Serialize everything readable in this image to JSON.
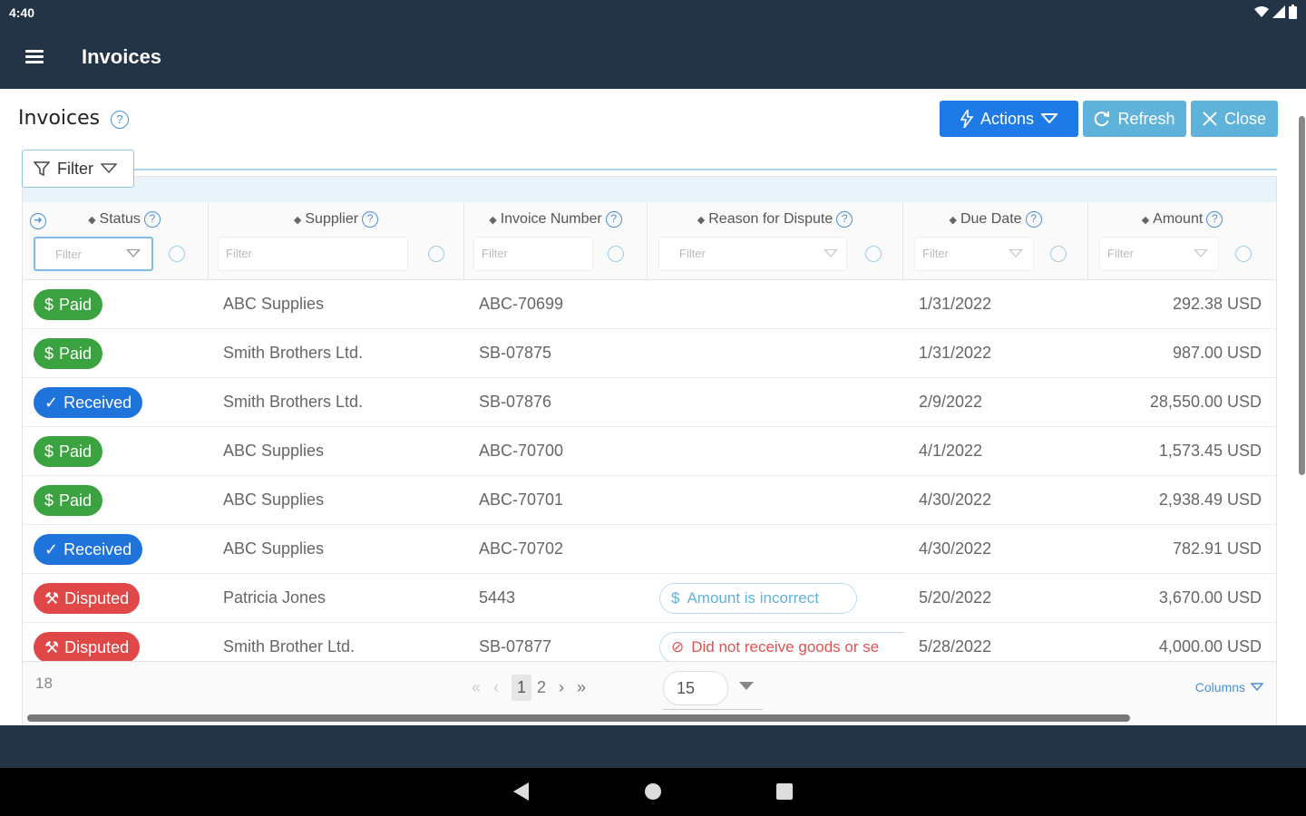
{
  "status_bar": {
    "time": "4:40"
  },
  "app_bar": {
    "title": "Invoices"
  },
  "page": {
    "title": "Invoices",
    "help_glyph": "?"
  },
  "toolbar": {
    "actions_label": "Actions",
    "refresh_label": "Refresh",
    "close_label": "Close"
  },
  "filter": {
    "label": "Filter"
  },
  "columns": [
    {
      "key": "status",
      "label": "Status",
      "filter_placeholder": "Filter"
    },
    {
      "key": "supplier",
      "label": "Supplier",
      "filter_placeholder": "Filter"
    },
    {
      "key": "invoice_number",
      "label": "Invoice Number",
      "filter_placeholder": "Filter"
    },
    {
      "key": "reason",
      "label": "Reason for Dispute",
      "filter_placeholder": "Filter"
    },
    {
      "key": "due_date",
      "label": "Due Date",
      "filter_placeholder": "Filter"
    },
    {
      "key": "amount",
      "label": "Amount",
      "filter_placeholder": "Filter"
    }
  ],
  "rows": [
    {
      "status": "Paid",
      "supplier": "ABC Supplies",
      "invoice_number": "ABC-70699",
      "reason": "",
      "due_date": "1/31/2022",
      "amount": "292.38 USD"
    },
    {
      "status": "Paid",
      "supplier": "Smith Brothers Ltd.",
      "invoice_number": "SB-07875",
      "reason": "",
      "due_date": "1/31/2022",
      "amount": "987.00 USD"
    },
    {
      "status": "Received",
      "supplier": "Smith Brothers Ltd.",
      "invoice_number": "SB-07876",
      "reason": "",
      "due_date": "2/9/2022",
      "amount": "28,550.00 USD"
    },
    {
      "status": "Paid",
      "supplier": "ABC Supplies",
      "invoice_number": "ABC-70700",
      "reason": "",
      "due_date": "4/1/2022",
      "amount": "1,573.45 USD"
    },
    {
      "status": "Paid",
      "supplier": "ABC Supplies",
      "invoice_number": "ABC-70701",
      "reason": "",
      "due_date": "4/30/2022",
      "amount": "2,938.49 USD"
    },
    {
      "status": "Received",
      "supplier": "ABC Supplies",
      "invoice_number": "ABC-70702",
      "reason": "",
      "due_date": "4/30/2022",
      "amount": "782.91 USD"
    },
    {
      "status": "Disputed",
      "supplier": "Patricia Jones",
      "invoice_number": "5443",
      "reason": "Amount is incorrect",
      "due_date": "5/20/2022",
      "amount": "3,670.00 USD"
    },
    {
      "status": "Disputed",
      "supplier": "Smith Brother Ltd.",
      "invoice_number": "SB-07877",
      "reason": "Did not receive goods or se",
      "due_date": "5/28/2022",
      "amount": "4,000.00 USD"
    }
  ],
  "footer": {
    "total": "18",
    "pages": [
      "1",
      "2"
    ],
    "page_size": "15",
    "columns_label": "Columns"
  },
  "colors": {
    "paid": "#3aa33f",
    "received": "#1f74db",
    "disputed": "#e04848",
    "appbar": "#243447",
    "accent": "#1e7ae6"
  }
}
